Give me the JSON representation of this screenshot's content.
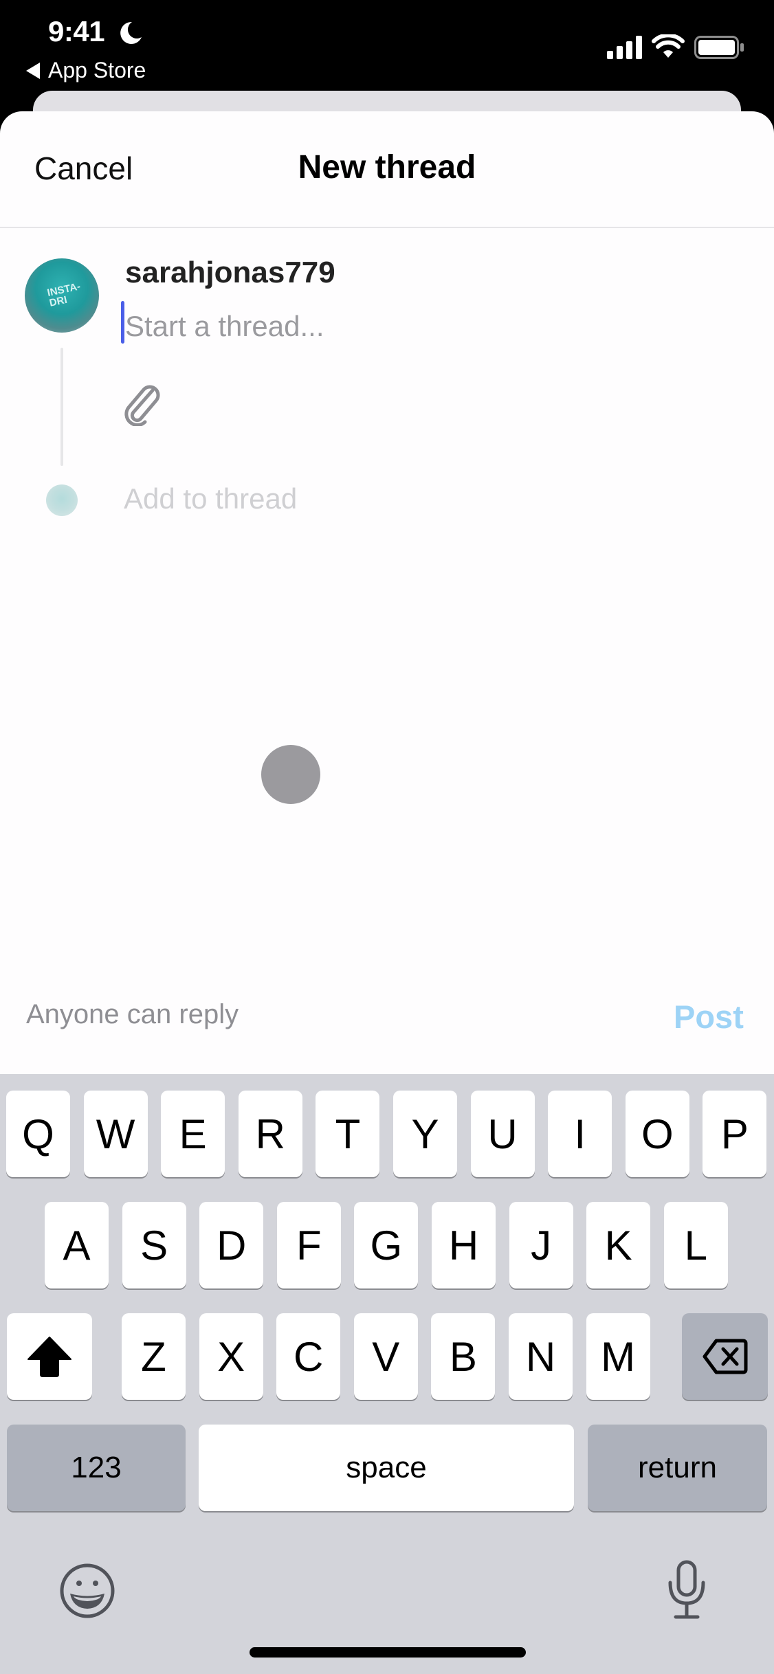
{
  "status_bar": {
    "time": "9:41",
    "focus_icon": "moon-icon",
    "back_label": "App Store",
    "icons": [
      "cellular-signal-icon",
      "wifi-icon",
      "battery-icon"
    ]
  },
  "header": {
    "cancel_label": "Cancel",
    "title": "New thread"
  },
  "composer": {
    "username": "sarahjonas779",
    "input_value": "",
    "input_placeholder": "Start a thread...",
    "attach_icon": "paperclip-icon",
    "add_to_thread_label": "Add to thread"
  },
  "footer": {
    "reply_setting_label": "Anyone can reply",
    "post_label": "Post"
  },
  "colors": {
    "post_disabled": "#9dd3f6",
    "cursor": "#4a5ee8",
    "keyboard_bg": "#d3d4da",
    "key_dark": "#adb1bb"
  },
  "keyboard": {
    "row1": [
      "Q",
      "W",
      "E",
      "R",
      "T",
      "Y",
      "U",
      "I",
      "O",
      "P"
    ],
    "row2": [
      "A",
      "S",
      "D",
      "F",
      "G",
      "H",
      "J",
      "K",
      "L"
    ],
    "row3": [
      "Z",
      "X",
      "C",
      "V",
      "B",
      "N",
      "M"
    ],
    "shift_icon": "shift-icon",
    "delete_icon": "delete-icon",
    "numbers_label": "123",
    "space_label": "space",
    "return_label": "return",
    "emoji_icon": "emoji-icon",
    "mic_icon": "microphone-icon"
  }
}
